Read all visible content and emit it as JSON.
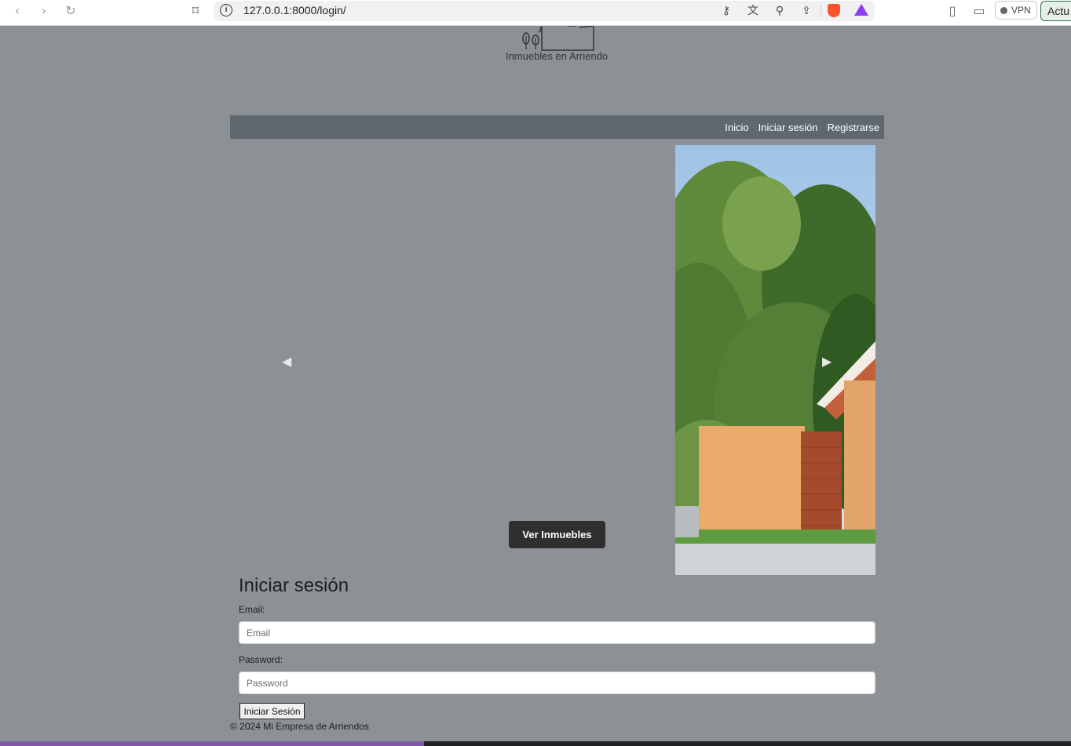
{
  "browser": {
    "url": "127.0.0.1:8000/login/",
    "vpn_label": "VPN",
    "profile_label": "Actu",
    "icons": {
      "back": "back-arrow-icon",
      "forward": "forward-arrow-icon",
      "reload": "reload-icon",
      "bookmark": "bookmark-icon",
      "site_info": "info-icon",
      "key": "key-icon",
      "translate": "translate-icon",
      "zoom": "zoom-icon",
      "share": "share-icon",
      "brave": "brave-shield-icon",
      "rewards": "rewards-triangle-icon",
      "sidebar": "sidebar-icon",
      "wallet": "wallet-icon"
    }
  },
  "header": {
    "logo_text": "Inmuebles en Arriendo"
  },
  "nav": {
    "links": [
      "Inicio",
      "Iniciar sesión",
      "Registrarse"
    ]
  },
  "carousel": {
    "prev_icon": "chevron-left-icon",
    "next_icon": "chevron-right-icon",
    "button_label": "Ver Inmuebles"
  },
  "login": {
    "title": "Iniciar sesión",
    "email_label": "Email:",
    "email_placeholder": "Email",
    "password_label": "Password:",
    "password_placeholder": "Password",
    "submit_label": "Iniciar Sesión"
  },
  "footer": {
    "text": "© 2024 Mi Empresa de Arriendos"
  },
  "colors": {
    "page_bg": "#8d9196",
    "navbar_bg": "#5f686f",
    "button_dark": "#2f2f30"
  }
}
